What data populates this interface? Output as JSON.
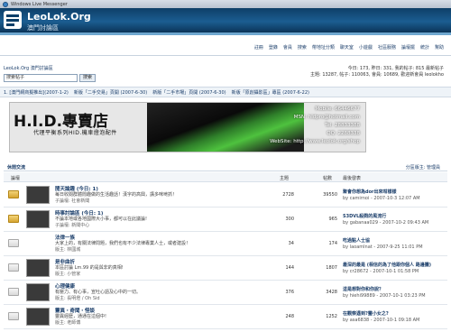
{
  "window": {
    "title": "Windows Live Messenger"
  },
  "banner": {
    "site": "LeoLok.Org",
    "subtitle": "澳門討論區"
  },
  "nav": [
    "註冊",
    "登錄",
    "會員",
    "搜索",
    "帶地址分類",
    "聊天室",
    "小遊戲",
    "社區服務",
    "論壇擺",
    "統計",
    "幫助"
  ],
  "info": {
    "breadcrumb": "LeoLok.Org 澳門討論區",
    "stats_line1": "今日: 173, 昨日: 331, 我的帖子: 815  最新帖子",
    "stats_line2": "主題: 13287, 帖子: 110063, 會員: 10689, 歡迎新會員 leolokho",
    "search_placeholder": "搜索帖子",
    "search_button": "搜索"
  },
  "announcements": [
    "1. [澳門網商擬推出](2007-1-2)",
    "新版「二手交易」頁開 (2007-6-30)",
    "新版「二手市場」頁開 (2007-6-30)",
    "新版「原創攝影區」專區 (2007-6-22)"
  ],
  "ad": {
    "hid": "H.I.D.專賣店",
    "slogan": "代理平衡系列HID.機車燈泡配件",
    "contact": [
      "Mobile: 66446677",
      "MSN: hidpro@hotmail.com",
      "Tel: 28833388",
      "QQ: 2288338",
      "WebSite: http://www.leolok.org/shop"
    ]
  },
  "category": {
    "name": "休閒交流",
    "moderators": "分區版主: 管理員"
  },
  "columns": {
    "forum": "論壇",
    "topics": "主題",
    "posts": "帖數",
    "last": "最後發表"
  },
  "forums": [
    {
      "status": "new",
      "thumb": true,
      "title": "閒天論趣 (今日: 1)",
      "desc": "每日收閱群體閒趣做的生活趣話！漢字的高興，講多咪哋抓！",
      "mod": "子論壇: 社會新聞",
      "mod2": "版主: leoiu, lol4763, 200+",
      "topics": "2728",
      "posts": "39550",
      "lp_title": "聚會你想為dor出來咁樣樣",
      "lp_meta": "by camirnoi - 2007-10-3 12:07 AM"
    },
    {
      "status": "new",
      "thumb": true,
      "title": "時事討論區 (今日: 1)",
      "desc": "不論本地或各地國際大小事，都可以在此議論!",
      "mod": "子論壇: 新聞中心",
      "mod2": "",
      "topics": "300",
      "posts": "965",
      "lp_title": "S3DVL殺戮的風流行",
      "lp_meta": "by gabanaa029 - 2007-10-2 09:43 AM"
    },
    {
      "status": "old",
      "thumb": false,
      "title": "法律一族",
      "desc": "大家上的，有關法律問題，我們也有不少法律專業人士，或者建設！",
      "mod": "版主: 林國城",
      "mod2": "",
      "topics": "34",
      "posts": "174",
      "lp_title": "吃過點人士協",
      "lp_meta": "by laoamlnat - 2007-9-25 11:01 PM"
    },
    {
      "status": "old",
      "thumb": true,
      "title": "是非曲折",
      "desc": "本區討論 Lm.99 的是與非的真相!",
      "mod": "版主: 小管家",
      "mod2": "",
      "topics": "144",
      "posts": "1807",
      "lp_title": "最深的最是 (相信的為了他跟你個人 路邊攤)",
      "lp_meta": "by cr28672 - 2007-10-1 01:58 PM"
    },
    {
      "status": "old",
      "thumb": true,
      "title": "心理健康",
      "desc": "有壓力、有心事，宣吐心語及心中的一切。",
      "mod": "版主: 長明燈 / Oh Sid",
      "mod2": "",
      "topics": "376",
      "posts": "3428",
      "lp_title": "這是想對你和你說？",
      "lp_meta": "by hiehi99889 - 2007-10-1 03:23 PM"
    },
    {
      "status": "old",
      "thumb": true,
      "title": "靈異・奇聞・怪談",
      "desc": "靈異經歷，通通在這個中!",
      "mod": "版主: 老師傅",
      "mod2": "",
      "topics": "248",
      "posts": "1252",
      "lp_title": "在觀察遇到?靈小女之?",
      "lp_meta": "by asa6838 - 2007-10-1 09:18 AM"
    }
  ]
}
